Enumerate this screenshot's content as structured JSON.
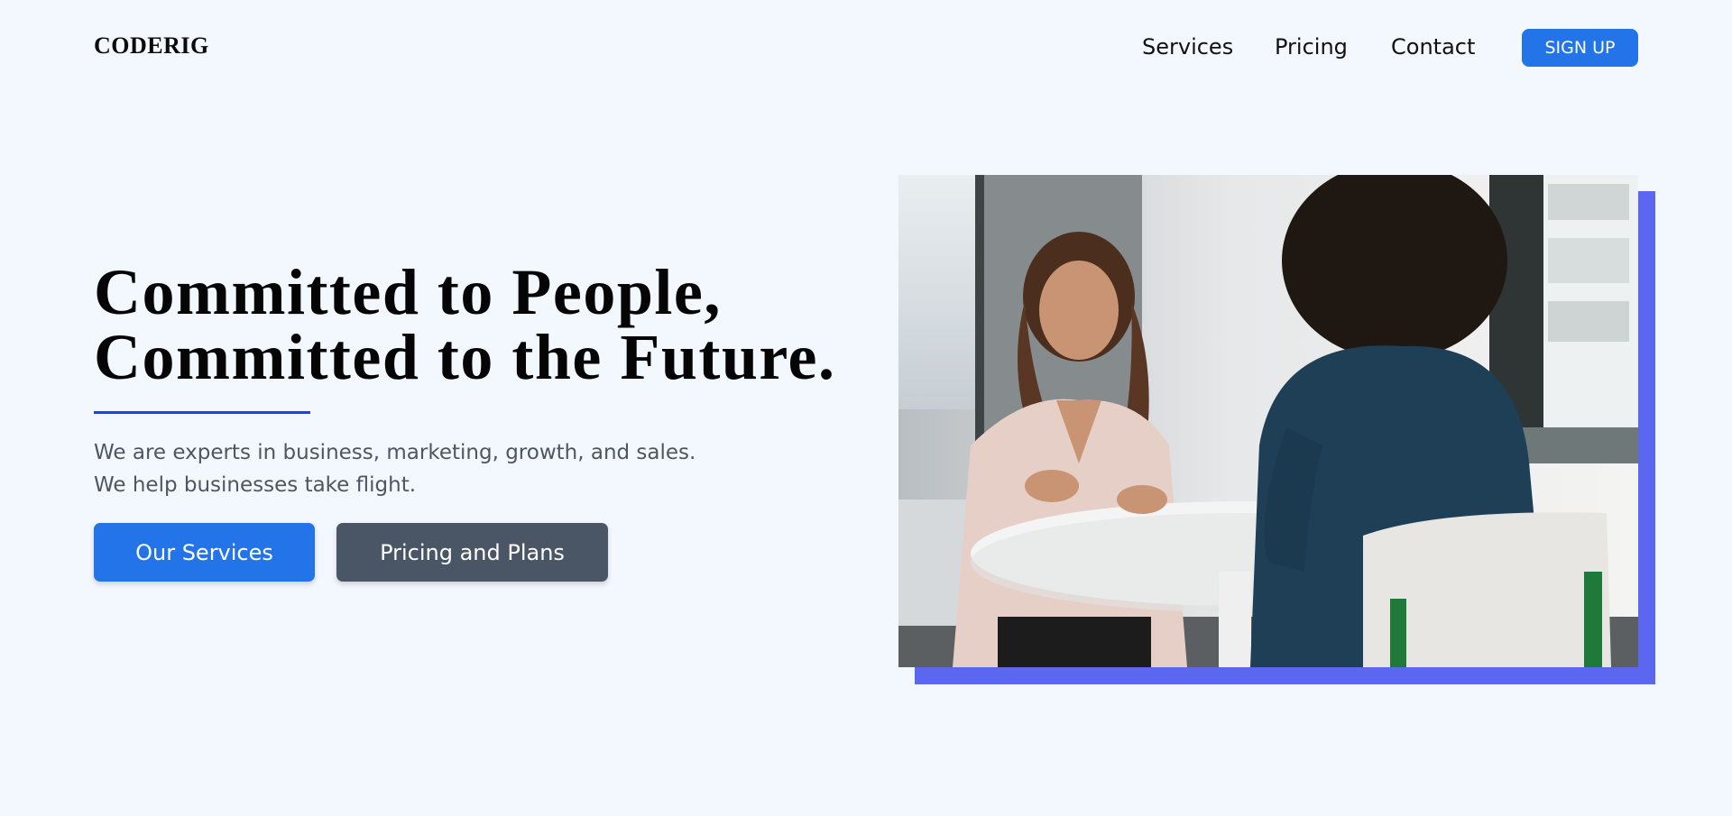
{
  "brand": {
    "logo_text": "CODERIG"
  },
  "nav": {
    "links": [
      "Services",
      "Pricing",
      "Contact"
    ],
    "signup_label": "SIGN UP"
  },
  "hero": {
    "title_lines": [
      "Committed to People,",
      "Committed to the Future."
    ],
    "subtitle_lines": [
      "We are experts in business, marketing, growth, and sales.",
      "We help businesses take flight."
    ],
    "primary_button": "Our Services",
    "secondary_button": "Pricing and Plans"
  },
  "image": {
    "subject": "two-women-meeting-at-table-photo"
  },
  "colors": {
    "background": "#f3f8fe",
    "primary": "#2274e8",
    "secondary": "#4a5566",
    "accent_line": "#2346b8",
    "image_shadow": "#5b67ee"
  }
}
